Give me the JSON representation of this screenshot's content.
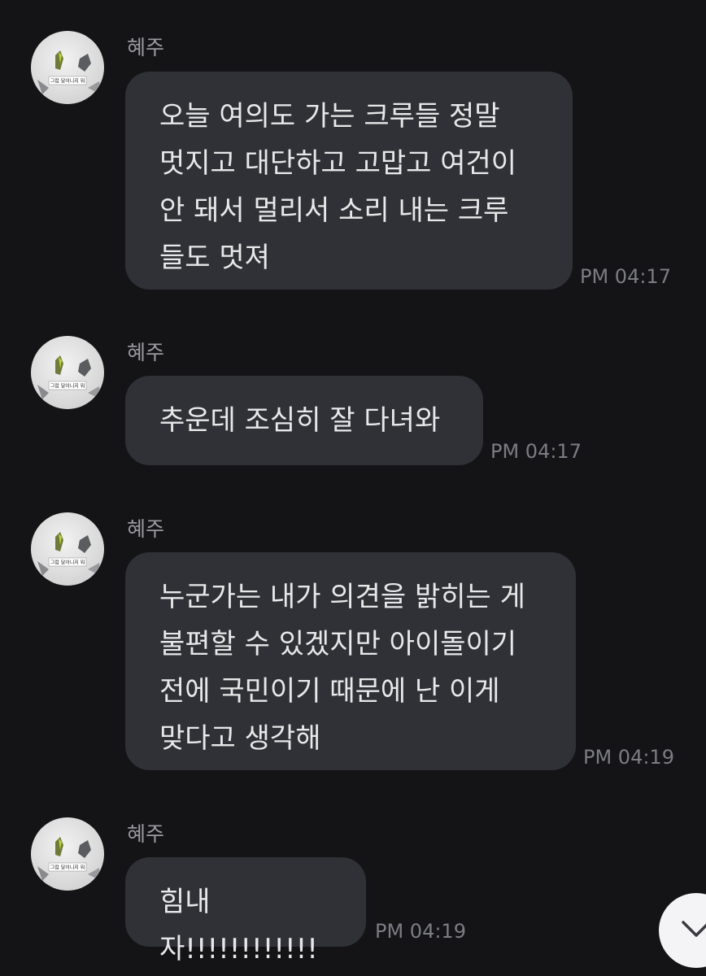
{
  "messages": [
    {
      "sender": "혜주",
      "text": "오늘 여의도 가는 크루들 정말\n멋지고 대단하고 고맙고 여건이\n안 돼서 멀리서 소리 내는 크루\n들도 멋져",
      "time": "PM 04:17"
    },
    {
      "sender": "혜주",
      "text": "추운데 조심히 잘 다녀와",
      "time": "PM 04:17"
    },
    {
      "sender": "혜주",
      "text": "누군가는 내가 의견을 밝히는 게\n불편할 수 있겠지만 아이돌이기\n전에 국민이기 때문에 난 이게\n맞다고 생각해",
      "time": "PM 04:19"
    },
    {
      "sender": "혜주",
      "text": "힘내자!!!!!!!!!!!!",
      "time": "PM 04:19"
    }
  ],
  "avatar_caption": "그럼 달이니지 뭐",
  "scroll_button_icon": "chevron-down-icon",
  "colors": {
    "background": "#141416",
    "bubble": "#2f3136",
    "bubble_text": "#e8e8ea",
    "sender": "#9a9aa0",
    "time": "#7c7d83"
  }
}
